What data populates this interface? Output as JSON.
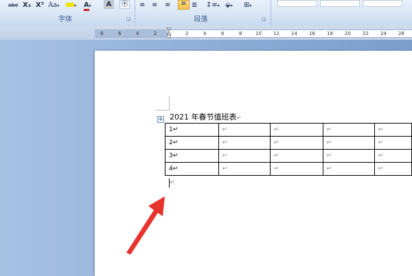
{
  "ribbon": {
    "font_group_label": "字体",
    "paragraph_group_label": "段落",
    "buttons": {
      "strikethrough": "abc",
      "subscript": "X₂",
      "superscript": "X²",
      "change_case": "Aa",
      "highlight": "ab",
      "font_color": "A",
      "character_shading": "A",
      "enclose_character": "㊉"
    }
  },
  "ruler": {
    "numbers": [
      "8",
      "6",
      "4",
      "2",
      "2",
      "4",
      "6",
      "8",
      "10",
      "12",
      "14",
      "16",
      "18",
      "20",
      "22",
      "24",
      "26"
    ]
  },
  "document": {
    "title": "2021 年春节值班表",
    "paragraph_mark": "↵",
    "table": {
      "rows": [
        [
          "1↵",
          "↵",
          "↵",
          "↵",
          "↵"
        ],
        [
          "2↵",
          "↵",
          "↵",
          "↵",
          "↵"
        ],
        [
          "3↵",
          "↵",
          "↵",
          "↵",
          "↵"
        ],
        [
          "4↵",
          "↵",
          "↵",
          "↵",
          "↵"
        ]
      ]
    },
    "table_handle_icon": "move-plus-icon"
  },
  "colors": {
    "ribbon_text": "#3b5a8a",
    "arrow": "#e8322d",
    "highlight_active": "#f7c04d"
  }
}
